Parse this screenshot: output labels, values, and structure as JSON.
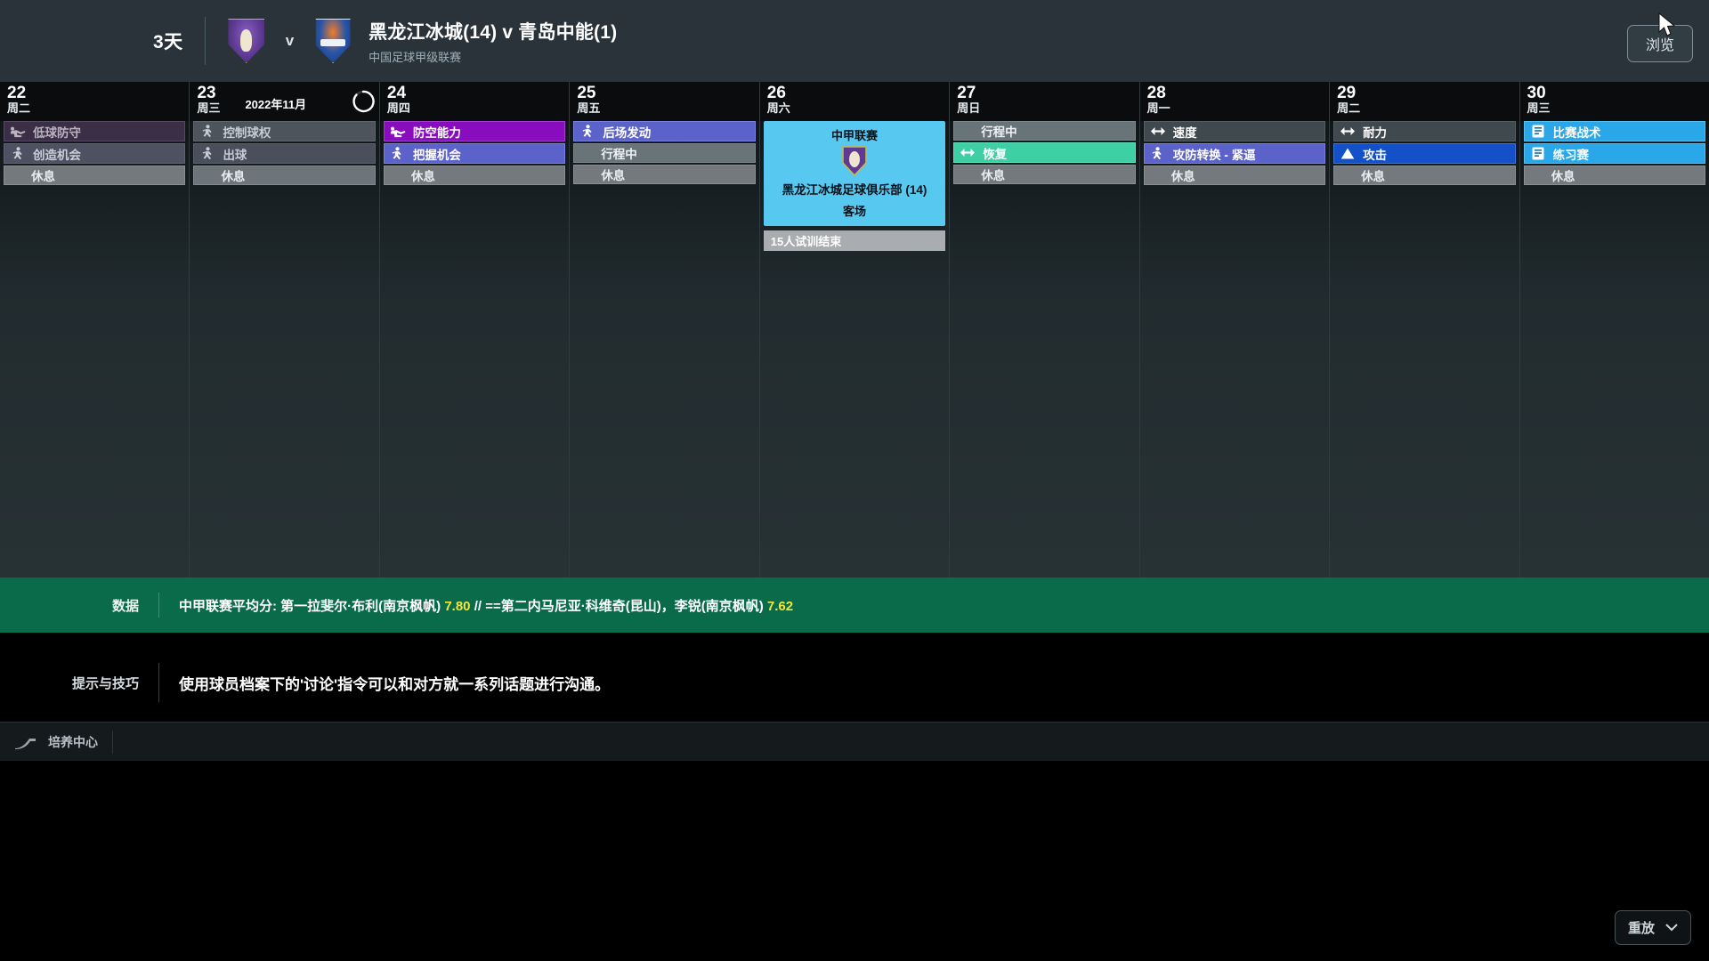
{
  "topbar": {
    "days_left": "3天",
    "home_crest_icon": "club-crest-home-icon",
    "vs_label": "v",
    "away_crest_icon": "club-crest-away-icon",
    "fixture_title": "黑龙江冰城(14) v 青岛中能(1)",
    "competition": "中国足球甲级联赛",
    "browse_label": "浏览",
    "cursor_icon": "mouse-pointer-icon"
  },
  "calendar": {
    "month_label": "2022年11月",
    "refresh_icon": "refresh-circle-icon",
    "days": [
      {
        "num": "22",
        "dow": "周二",
        "type": "training",
        "cells": [
          {
            "label": "低球防守",
            "icon": "player-tackle-icon",
            "bg": "#3a2f45",
            "fg": "#b9b3c2",
            "border": "#554a63"
          },
          {
            "label": "创造机会",
            "icon": "player-run-icon",
            "bg": "#4c5261",
            "fg": "#c9ced8",
            "border": "#5c6372"
          },
          {
            "label": "休息",
            "icon": "",
            "bg": "#74797d",
            "fg": "#e8ecef",
            "border": "#8a8f93"
          }
        ]
      },
      {
        "num": "23",
        "dow": "周三",
        "type": "training",
        "show_month": true,
        "cells": [
          {
            "label": "控制球权",
            "icon": "player-run-icon",
            "bg": "#4e545c",
            "fg": "#c6ccd4",
            "border": "#5f666e"
          },
          {
            "label": "出球",
            "icon": "player-run-icon",
            "bg": "#4a4f5c",
            "fg": "#c5cad6",
            "border": "#5a606c"
          },
          {
            "label": "休息",
            "icon": "",
            "bg": "#6d757a",
            "fg": "#e8ecef",
            "border": "#838a8f"
          }
        ]
      },
      {
        "num": "24",
        "dow": "周四",
        "type": "training",
        "cells": [
          {
            "label": "防空能力",
            "icon": "player-tackle-icon",
            "bg": "#8a0cbf",
            "fg": "#ffffff",
            "border": "#a23fd2"
          },
          {
            "label": "把握机会",
            "icon": "player-run-icon",
            "bg": "#5b62c9",
            "fg": "#ffffff",
            "border": "#7b82dd"
          },
          {
            "label": "休息",
            "icon": "",
            "bg": "#74797d",
            "fg": "#e8ecef",
            "border": "#8a8f93"
          }
        ]
      },
      {
        "num": "25",
        "dow": "周五",
        "type": "training",
        "cells": [
          {
            "label": "后场发动",
            "icon": "player-run-icon",
            "bg": "#5b62c9",
            "fg": "#ffffff",
            "border": "#7b82dd"
          },
          {
            "label": "行程中",
            "icon": "",
            "bg": "#697479",
            "fg": "#eef2f4",
            "border": "#7d888d"
          },
          {
            "label": "休息",
            "icon": "",
            "bg": "#74797d",
            "fg": "#e8ecef",
            "border": "#8a8f93"
          }
        ]
      },
      {
        "num": "26",
        "dow": "周六",
        "type": "match",
        "match": {
          "competition": "中甲联赛",
          "crest_icon": "opponent-crest-icon",
          "team": "黑龙江冰城足球俱乐部 (14)",
          "venue": "客场",
          "bg": "#57c8ef"
        },
        "trial": {
          "label": "15人试训结束",
          "bg": "#a9adb0"
        }
      },
      {
        "num": "27",
        "dow": "周日",
        "type": "training",
        "cells": [
          {
            "label": "行程中",
            "icon": "",
            "bg": "#697479",
            "fg": "#eef2f4",
            "border": "#7d888d"
          },
          {
            "label": "恢复",
            "icon": "arrows-horizontal-icon",
            "bg": "#3ecfa4",
            "fg": "#ffffff",
            "border": "#62e3bd"
          },
          {
            "label": "休息",
            "icon": "",
            "bg": "#74797d",
            "fg": "#e8ecef",
            "border": "#8a8f93"
          }
        ]
      },
      {
        "num": "28",
        "dow": "周一",
        "type": "training",
        "cells": [
          {
            "label": "速度",
            "icon": "arrows-horizontal-icon",
            "bg": "#40494e",
            "fg": "#ffffff",
            "border": "#555e63"
          },
          {
            "label": "攻防转换 - 紧逼",
            "icon": "player-run-icon",
            "bg": "#5b62c9",
            "fg": "#ffffff",
            "border": "#7b82dd"
          },
          {
            "label": "休息",
            "icon": "",
            "bg": "#74797d",
            "fg": "#e8ecef",
            "border": "#8a8f93"
          }
        ]
      },
      {
        "num": "29",
        "dow": "周二",
        "type": "training",
        "cells": [
          {
            "label": "耐力",
            "icon": "arrows-horizontal-icon",
            "bg": "#40494e",
            "fg": "#ffffff",
            "border": "#555e63"
          },
          {
            "label": "攻击",
            "icon": "triangle-up-icon",
            "bg": "#1450c8",
            "fg": "#ffffff",
            "border": "#3f74de"
          },
          {
            "label": "休息",
            "icon": "",
            "bg": "#74797d",
            "fg": "#e8ecef",
            "border": "#8a8f93"
          }
        ]
      },
      {
        "num": "30",
        "dow": "周三",
        "type": "training",
        "cells": [
          {
            "label": "比赛战术",
            "icon": "clipboard-icon",
            "bg": "#2aa7e8",
            "fg": "#ffffff",
            "border": "#57c0f0"
          },
          {
            "label": "练习赛",
            "icon": "clipboard-icon",
            "bg": "#2aa7e8",
            "fg": "#ffffff",
            "border": "#57c0f0"
          },
          {
            "label": "休息",
            "icon": "",
            "bg": "#74797d",
            "fg": "#e8ecef",
            "border": "#8a8f93"
          }
        ]
      }
    ]
  },
  "databar": {
    "label": "数据",
    "text_prefix": "中甲联赛平均分: 第一拉斐尔·布利(南京枫帆) ",
    "value1": "7.80",
    "text_middle": " // ==第二内马尼亚·科维奇(昆山)，李锐(南京枫帆) ",
    "value2": "7.62",
    "bg": "#0a6b4b",
    "value_color": "#f2e63a"
  },
  "tips": {
    "label": "提示与技巧",
    "text": "使用球员档案下的'讨论'指令可以和对方就一系列话题进行沟通。"
  },
  "footer": {
    "items": [
      {
        "label": "培养中心",
        "icon": "growth-curve-icon"
      }
    ]
  },
  "replay": {
    "label": "重放",
    "chevron_icon": "chevron-down-icon"
  }
}
